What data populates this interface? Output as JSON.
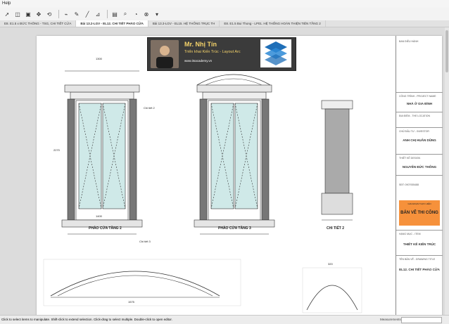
{
  "menu": {
    "help": "Help"
  },
  "tabs": [
    "E8. E1.5 x ĐỨC THÔNG - TSG, CHI TIẾT CỬA",
    "Bài 13.2-LGV - EL12. CHI TIẾT PHÀO CỬA",
    "Bài 13.3-LGV - EL15. HỆ THỐNG TRỤC TH",
    "E8. E1.5 Bui Thong - LP01. HỆ THỐNG HOÀN THIỆN TIÊN TẦNG 2"
  ],
  "banner": {
    "name": "Mr. Nhị Tín",
    "subtitle": "Triển khai Kiến Trúc - Layout Arc",
    "site": "www.itsacademy.vn"
  },
  "drawings": {
    "left_title": "PHÀO CỬA TẦNG 2",
    "mid_title": "PHÀO CỬA TẦNG 3",
    "right_title": "CHI TIẾT 2",
    "callout_2": "Chi tiết 2",
    "callout_3": "Chi tiết 3",
    "dim_top_1": "1300",
    "dim_top_2": "1400",
    "dim_height": "2270",
    "dim_bottom": "1575",
    "dim_right": "320"
  },
  "titleblock": {
    "ban_dieu_hanh": "BAN ĐIỀU HÀNH",
    "cong_trinh_label": "CÔNG TRÌNH - PROJECT NAME",
    "cong_trinh": "NHÀ Ở GIA ĐÌNH",
    "dia_diem_label": "ĐỊA ĐIỂM - THE LOCATION",
    "chu_dau_tu_label": "CHỦ ĐẦU TƯ - INVESTOR",
    "chu_dau_tu": "ANH CHỊ HUÂN DŨNG",
    "thiet_ke_label": "THIẾT KẾ DESIGN",
    "thiet_ke": "NGUYỄN ĐỨC THÔNG",
    "phone": "SĐT: 0907935488",
    "giai_doan_label": "GIAI ĐOẠN THỰC HIỆN",
    "giai_doan": "BẢN VẼ THI CÔNG",
    "hang_muc_label": "HẠNG MỤC - ITEM",
    "hang_muc": "THIẾT KẾ KIẾN TRÚC",
    "ten_ban_ve_label": "TÊN BẢN VẼ - DRAWING TITLE",
    "ten_ban_ve": "EL12. CHI TIẾT PHÀO CỬA"
  },
  "status": {
    "message": "Click to select items to manipulate. Shift-click to extend selection. Click-drag to select multiple. Double-click to open editor.",
    "measurements_label": "Measurements"
  },
  "colors": {
    "accent": "#f6913b",
    "banner_bg": "#3b3b3b",
    "banner_text": "#f5d36a"
  },
  "icons": [
    "select-arrow-icon",
    "eraser-icon",
    "paint-icon",
    "move-icon",
    "rotate-icon",
    "tape-icon",
    "pencil-icon",
    "line-icon",
    "dimension-icon",
    "text-icon",
    "zoom-icon",
    "orbit-icon",
    "pan-icon",
    "layers-icon"
  ]
}
